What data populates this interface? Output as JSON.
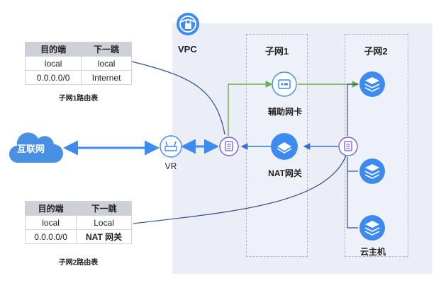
{
  "vpc": {
    "label": "VPC"
  },
  "subnets": [
    {
      "title": "子网1"
    },
    {
      "title": "子网2"
    }
  ],
  "internet": {
    "label": "互联网"
  },
  "router": {
    "label": "VR"
  },
  "nodes": {
    "eni": {
      "label": "辅助网卡"
    },
    "nat": {
      "label": "NAT网关"
    },
    "host": {
      "label": "云主机"
    }
  },
  "route_tables": [
    {
      "caption": "子网1路由表",
      "headers": [
        "目的端",
        "下一跳"
      ],
      "rows": [
        [
          "local",
          "local"
        ],
        [
          "0.0.0.0/0",
          "Internet"
        ]
      ]
    },
    {
      "caption": "子网2路由表",
      "headers": [
        "目的端",
        "下一跳"
      ],
      "rows": [
        [
          "local",
          "Local"
        ],
        [
          "0.0.0.0/0",
          "NAT 网关"
        ]
      ]
    }
  ],
  "colors": {
    "accent_blue": "#3d8bf2",
    "router_purple": "#6c5ce7",
    "link_green": "#6ab04c",
    "line_navy": "#2f4f8f"
  }
}
